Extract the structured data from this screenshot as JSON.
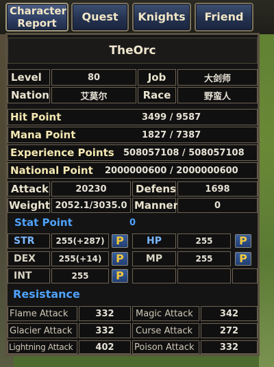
{
  "tabs": {
    "character_report": "Character Report",
    "quest": "Quest",
    "knights": "Knights",
    "friend": "Friend"
  },
  "character": {
    "name": "TheOrc",
    "level_label": "Level",
    "level": "80",
    "job_label": "Job",
    "job": "大剑师",
    "nation_label": "Nation",
    "nation": "艾莫尔",
    "race_label": "Race",
    "race": "野蛮人"
  },
  "stats": {
    "hit_point_label": "Hit Point",
    "hit_point": "3499 / 9587",
    "mana_point_label": "Mana Point",
    "mana_point": "1827 / 7387",
    "experience_label": "Experience Points",
    "experience": "508057108 / 508057108",
    "national_label": "National Point",
    "national": "2000000600 / 2000000600",
    "attack_label": "Attack",
    "attack": "20230",
    "defens_label": "Defens",
    "defens": "1698",
    "weight_label": "Weight",
    "weight": "2052.1/3035.0",
    "manner_label": "Manner",
    "manner": "0"
  },
  "stat_points": {
    "label": "Stat Point",
    "value": "0",
    "str_label": "STR",
    "str": "255(+287)",
    "dex_label": "DEX",
    "dex": "255(+14)",
    "int_label": "INT",
    "int": "255",
    "hp_label": "HP",
    "hp": "255",
    "mp_label": "MP",
    "mp": "255",
    "p_button": "P"
  },
  "resistance": {
    "title": "Resistance",
    "flame_label": "Flame Attack",
    "flame": "332",
    "magic_label": "Magic Attack",
    "magic": "342",
    "glacier_label": "Glacier Attack",
    "glacier": "332",
    "curse_label": "Curse Attack",
    "curse": "272",
    "lightning_label": "Lightning Attack",
    "lightning": "402",
    "poison_label": "Poison Attack",
    "poison": "332"
  },
  "colors": {
    "accent_blue": "#4ea3ff",
    "p_button_gold": "#f2c93c",
    "panel_bg": "#151414"
  }
}
